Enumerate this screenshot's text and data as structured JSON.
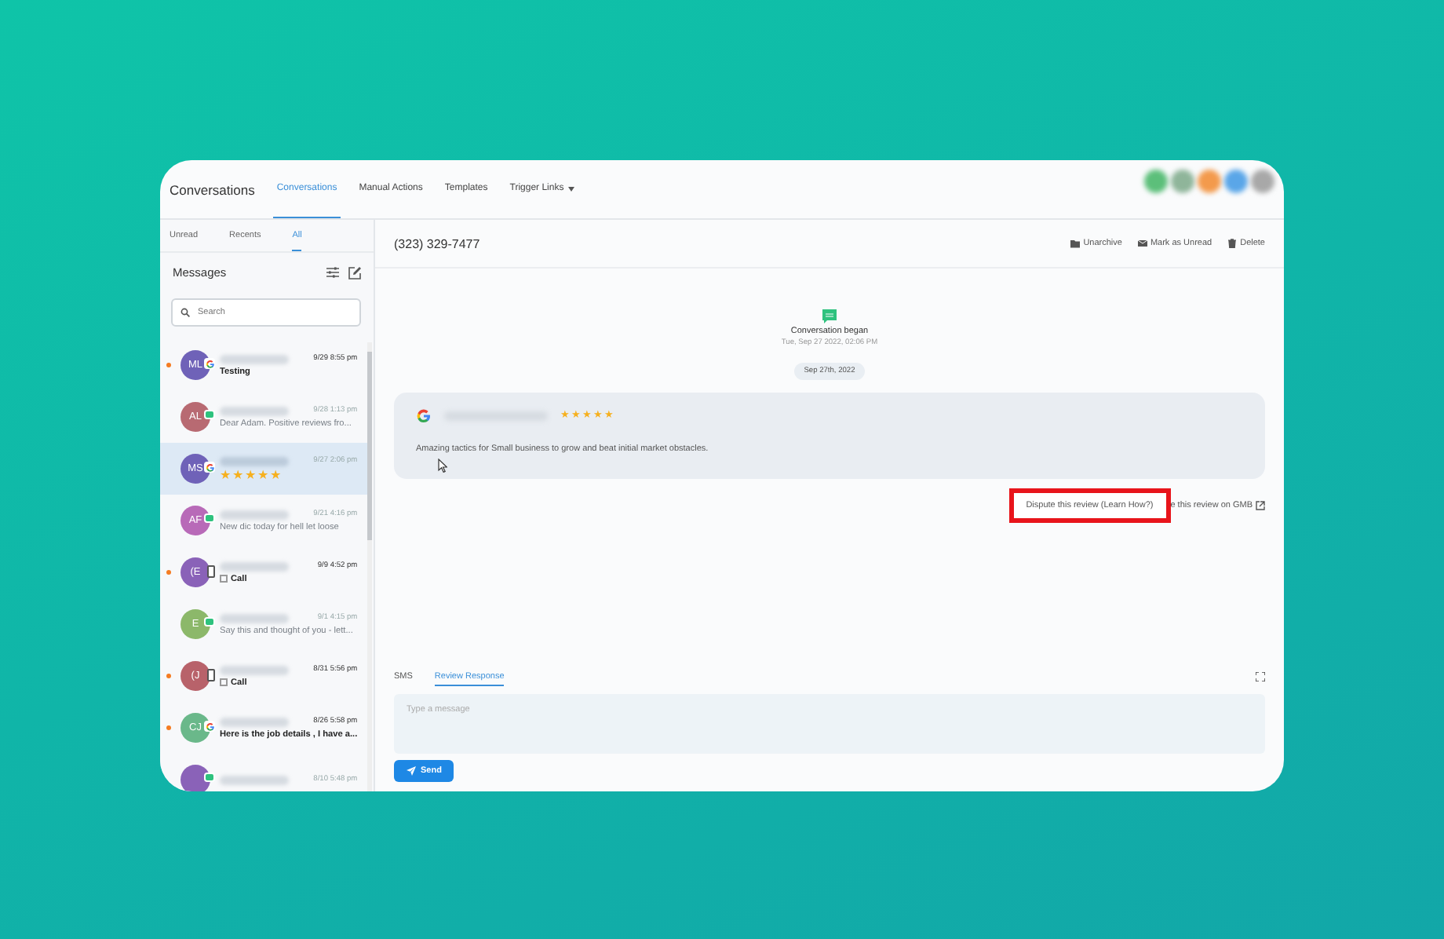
{
  "header": {
    "title": "Conversations",
    "nav": [
      {
        "label": "Conversations",
        "selected": true
      },
      {
        "label": "Manual Actions",
        "selected": false
      },
      {
        "label": "Templates",
        "selected": false
      },
      {
        "label": "Trigger Links",
        "selected": false,
        "dropdown": true
      }
    ],
    "avatars": [
      {
        "color": "#5cbf7a"
      },
      {
        "color": "#8fb59a"
      },
      {
        "color": "#f39a4c"
      },
      {
        "color": "#5aa6e8"
      },
      {
        "color": "#a8a8a8"
      }
    ]
  },
  "sidebar": {
    "filters": [
      {
        "label": "Unread",
        "selected": false
      },
      {
        "label": "Recents",
        "selected": false
      },
      {
        "label": "All",
        "selected": true
      }
    ],
    "heading": "Messages",
    "search": {
      "placeholder": "Search"
    },
    "conversations": [
      {
        "kind": "google",
        "initials": "ML",
        "color": "#6f62b8",
        "unread": true,
        "selected": false,
        "time": "9/29 8:55 pm",
        "preview": "Testing"
      },
      {
        "kind": "sms",
        "initials": "AL",
        "color": "#b86a72",
        "unread": false,
        "selected": false,
        "time": "9/28 1:13 pm",
        "preview": "Dear Adam. Positive reviews fro..."
      },
      {
        "kind": "google",
        "initials": "MS",
        "color": "#6f62b8",
        "unread": false,
        "selected": true,
        "time": "9/27 2:06 pm",
        "stars": 5
      },
      {
        "kind": "sms",
        "initials": "AF",
        "color": "#b86ab8",
        "unread": false,
        "selected": false,
        "time": "9/21 4:16 pm",
        "preview": "New dic today for hell let loose"
      },
      {
        "kind": "call",
        "initials": "(E",
        "color": "#8a62b8",
        "unread": true,
        "selected": false,
        "time": "9/9 4:52 pm",
        "preview": "Call"
      },
      {
        "kind": "sms",
        "initials": "E",
        "color": "#8cb86a",
        "unread": false,
        "selected": false,
        "time": "9/1 4:15 pm",
        "preview": "Say this and thought of you - lett..."
      },
      {
        "kind": "call",
        "initials": "(J",
        "color": "#b8626a",
        "unread": true,
        "selected": false,
        "time": "8/31 5:56 pm",
        "preview": "Call"
      },
      {
        "kind": "google",
        "initials": "CJ",
        "color": "#6ab88a",
        "unread": true,
        "selected": false,
        "time": "8/26 5:58 pm",
        "preview": "Here is the job details , I have a..."
      },
      {
        "kind": "sms",
        "color": "#8a62b8",
        "unread": false,
        "selected": false,
        "time": "8/10 5:48 pm"
      }
    ]
  },
  "conversation": {
    "phone": "(323) 329-7477",
    "actions": [
      {
        "label": "Unarchive"
      },
      {
        "label": "Mark as Unread"
      },
      {
        "label": "Delete"
      }
    ],
    "event": {
      "title": "Conversation began",
      "time": "Tue, Sep 27 2022, 02:06 PM"
    },
    "date": "Sep 27th, 2022",
    "review": {
      "stars": 5,
      "text": "Amazing tactics for Small business to grow and beat initial market obstacles."
    },
    "dispute_link": "Dispute this review (Learn How?)",
    "gmb_link": "e this review on GMB"
  },
  "composer": {
    "tabs": [
      {
        "label": "SMS",
        "selected": false
      },
      {
        "label": "Review Response",
        "selected": true
      }
    ],
    "placeholder": "Type a message",
    "send": "Send"
  }
}
